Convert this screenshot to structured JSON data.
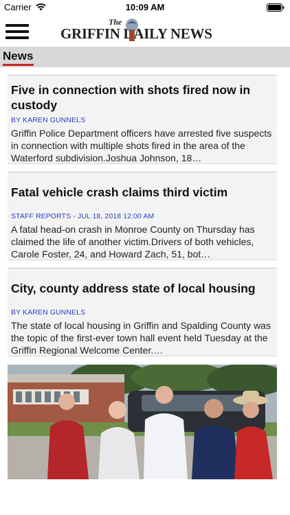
{
  "status_bar": {
    "carrier": "Carrier",
    "time": "10:09 AM"
  },
  "header": {
    "logo_the": "The",
    "logo_text": "GRIFFIN DAILY NEWS",
    "menu_icon": "hamburger-menu-icon"
  },
  "tabs": [
    {
      "label": "News",
      "active": true,
      "underline_color": "#cc2222"
    }
  ],
  "articles": [
    {
      "title": "Five in connection with shots fired now in custody",
      "byline": "BY KAREN GUNNELS",
      "summary": "Griffin Police Department officers have arrested five suspects in connection with multiple shots fired in the area of the Waterford subdivision.Joshua Johnson, 18…"
    },
    {
      "title": "Fatal vehicle crash claims third victim",
      "byline": "STAFF REPORTS - Jul 18, 2018 12:00 AM",
      "summary": "A fatal head-on crash in Monroe County on Thursday has claimed the life of another victim.Drivers of both vehicles, Carole Foster, 24, and Howard Zach, 51, bot…"
    },
    {
      "title": "City, county address state of local housing",
      "byline": "BY KAREN GUNNELS",
      "summary": "The state of local housing in Griffin and Spalding County was the topic of the first-ever town hall event held Tuesday at the Griffin Regional Welcome Center.…"
    }
  ],
  "colors": {
    "byline": "#2b3fbf",
    "card_bg": "#f3f3f3",
    "tab_bar_bg": "#d8d8d8"
  }
}
